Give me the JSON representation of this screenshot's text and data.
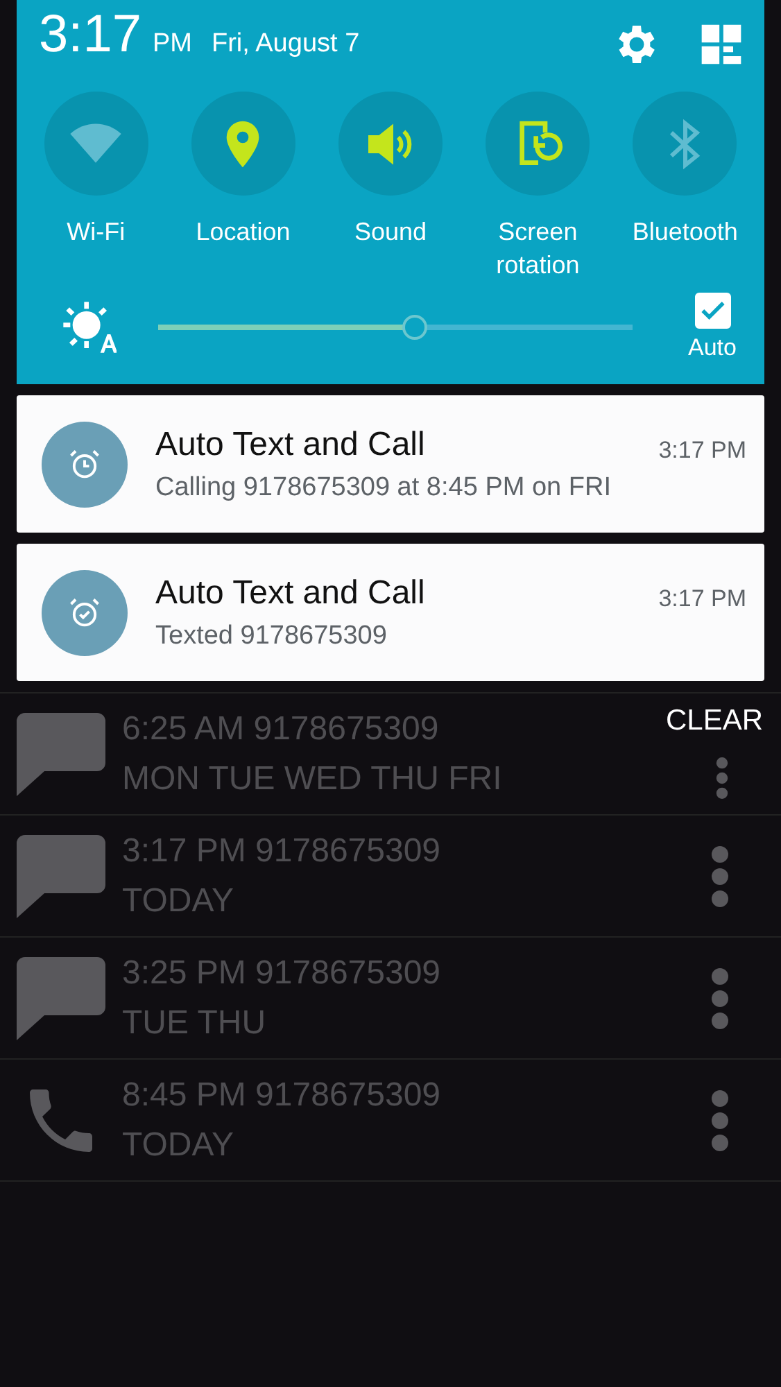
{
  "status": {
    "time": "3:17",
    "ampm": "PM",
    "date": "Fri, August 7"
  },
  "toggles": [
    {
      "kind": "wifi",
      "label": "Wi-Fi",
      "on": false
    },
    {
      "kind": "location",
      "label": "Location",
      "on": true
    },
    {
      "kind": "sound",
      "label": "Sound",
      "on": true
    },
    {
      "kind": "rotation",
      "label": "Screen rotation",
      "on": true
    },
    {
      "kind": "bluetooth",
      "label": "Bluetooth",
      "on": false
    }
  ],
  "brightness": {
    "level": 0.54,
    "auto_label": "Auto",
    "auto_checked": true
  },
  "notifications": [
    {
      "kind": "alarm",
      "title": "Auto Text and Call",
      "time": "3:17 PM",
      "text": "Calling 9178675309 at 8:45 PM on FRI"
    },
    {
      "kind": "alarm-check",
      "title": "Auto Text and Call",
      "time": "3:17 PM",
      "text": "Texted 9178675309"
    }
  ],
  "clear_label": "CLEAR",
  "schedule": [
    {
      "kind": "message",
      "line1": "6:25 AM 9178675309",
      "line2": "MON TUE WED THU FRI"
    },
    {
      "kind": "message",
      "line1": "3:17 PM 9178675309",
      "line2": "TODAY"
    },
    {
      "kind": "message",
      "line1": "3:25 PM 9178675309",
      "line2": "TUE THU"
    },
    {
      "kind": "call",
      "line1": "8:45 PM 9178675309",
      "line2": "TODAY"
    }
  ]
}
